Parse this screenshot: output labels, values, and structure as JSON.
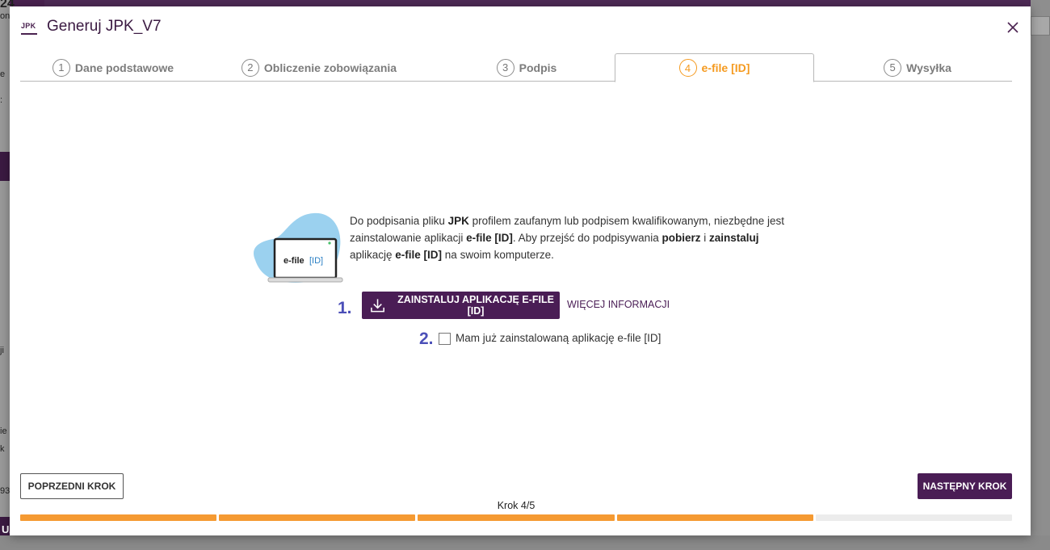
{
  "modal": {
    "logo_text": "JPK",
    "title": "Generuj JPK_V7"
  },
  "steps": [
    {
      "num": "1",
      "label": "Dane podstawowe",
      "active": false
    },
    {
      "num": "2",
      "label": "Obliczenie zobowiązania",
      "active": false
    },
    {
      "num": "3",
      "label": "Podpis",
      "active": false
    },
    {
      "num": "4",
      "label": "e-file [ID]",
      "active": true
    },
    {
      "num": "5",
      "label": "Wysyłka",
      "active": false
    }
  ],
  "content": {
    "illustration_label_a": "e-file",
    "illustration_label_b": "[ID]",
    "description_html": "Do podpisania pliku <b>JPK</b> profilem zaufanym lub podpisem kwalifikowanym, niezbędne jest zainstalowanie aplikacji <b>e-file [ID]</b>. Aby przejść do podpisywania <b>pobierz</b> i <b>zainstaluj</b> aplikację <b>e-file [ID]</b> na swoim komputerze.",
    "marker_1": "1.",
    "marker_2": "2.",
    "install_button": "ZAINSTALUJ APLIKACJĘ E-FILE [ID]",
    "more_info_link": "WIĘCEJ INFORMACJI",
    "checkbox_label": "Mam już zainstalowaną aplikację e-file [ID]",
    "checkbox_checked": false
  },
  "footer": {
    "prev_button": "POPRZEDNI KROK",
    "next_button": "NASTĘPNY KROK",
    "step_counter": "Krok 4/5",
    "progress_current": 4,
    "progress_total": 5
  },
  "background": {
    "frag_top": "24",
    "frag_on": "on",
    "frag_e": "e",
    "frag_colon": ":",
    "frag_ji": "ji",
    "frag_ie": "ie",
    "frag_k": "k",
    "frag_93": "93",
    "frag_uz": "UŻ"
  },
  "colors": {
    "accent_purple": "#4a1d55",
    "accent_orange": "#f59a1f",
    "marker_blue": "#4b4fb8",
    "illustration_blob": "#9bd1ef"
  }
}
